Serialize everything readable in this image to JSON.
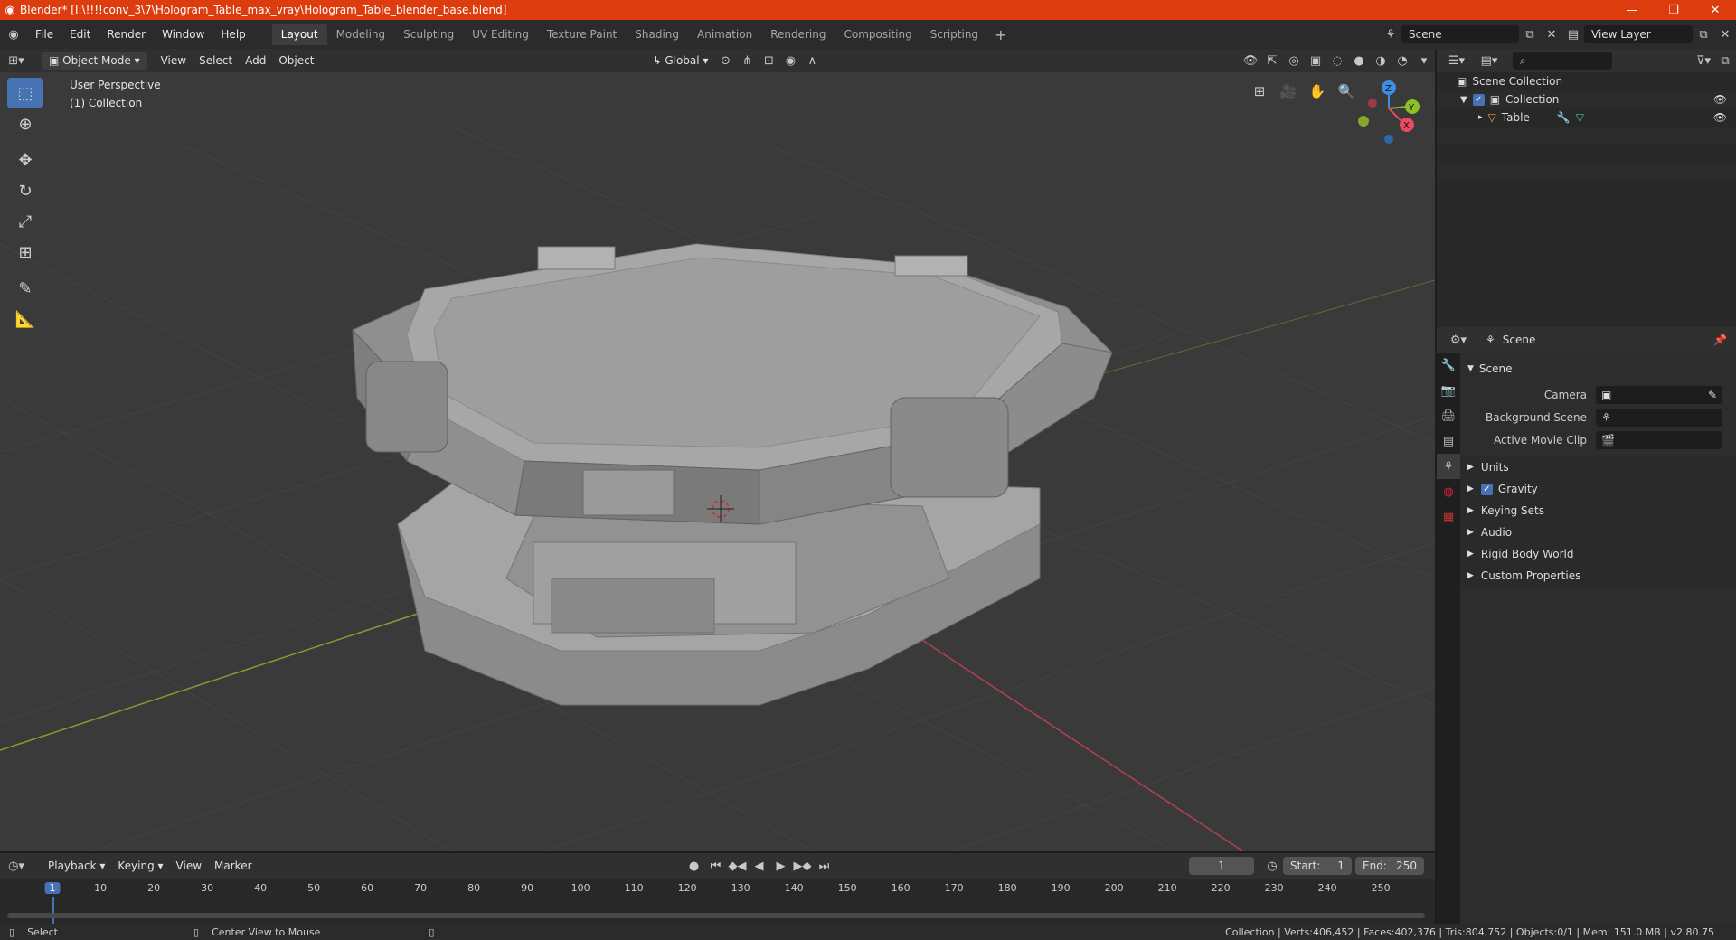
{
  "window": {
    "title": "Blender* [I:\\!!!!conv_3\\7\\Hologram_Table_max_vray\\Hologram_Table_blender_base.blend]",
    "minimize_icon": "minimize-icon",
    "maximize_icon": "restore-icon",
    "close_icon": "close-icon"
  },
  "menu": [
    "File",
    "Edit",
    "Render",
    "Window",
    "Help"
  ],
  "workspaces": [
    "Layout",
    "Modeling",
    "Sculpting",
    "UV Editing",
    "Texture Paint",
    "Shading",
    "Animation",
    "Rendering",
    "Compositing",
    "Scripting"
  ],
  "active_workspace": "Layout",
  "scene_field": "Scene",
  "view_layer_field": "View Layer",
  "viewport_header": {
    "mode": "Object Mode",
    "menus": [
      "View",
      "Select",
      "Add",
      "Object"
    ],
    "orientation": "Global"
  },
  "viewport": {
    "perspective": "User Perspective",
    "collection": "(1) Collection",
    "gizmo_axes": [
      "X",
      "Y",
      "Z"
    ]
  },
  "outliner": {
    "rows": [
      {
        "label": "Scene Collection"
      },
      {
        "label": "Collection"
      },
      {
        "label": "Table"
      }
    ]
  },
  "properties": {
    "context": "Scene",
    "panel_title": "Scene",
    "fields": [
      {
        "label": "Camera",
        "value": ""
      },
      {
        "label": "Background Scene",
        "value": ""
      },
      {
        "label": "Active Movie Clip",
        "value": ""
      }
    ],
    "subpanels": [
      "Units",
      "Gravity",
      "Keying Sets",
      "Audio",
      "Rigid Body World",
      "Custom Properties"
    ],
    "gravity_checked": true
  },
  "timeline": {
    "menus": [
      "Playback",
      "Keying",
      "View",
      "Marker"
    ],
    "current_frame": "1",
    "start_label": "Start:",
    "start_value": "1",
    "end_label": "End:",
    "end_value": "250",
    "ticks": [
      "1",
      "10",
      "20",
      "30",
      "40",
      "50",
      "60",
      "70",
      "80",
      "90",
      "100",
      "110",
      "120",
      "130",
      "140",
      "150",
      "160",
      "170",
      "180",
      "190",
      "200",
      "210",
      "220",
      "230",
      "240",
      "250"
    ]
  },
  "statusbar": {
    "left1": "Select",
    "left2": "Center View to Mouse",
    "right": "Collection | Verts:406,452 | Faces:402,376 | Tris:804,752 | Objects:0/1 | Mem: 151.0 MB | v2.80.75"
  },
  "colors": {
    "titlebar": "#dd3d0e",
    "accent": "#4772b3",
    "viewport_bg": "#3a3a3a",
    "axis_x": "#e84a5f",
    "axis_y": "#8cbf26",
    "axis_z": "#3d8ee0"
  }
}
